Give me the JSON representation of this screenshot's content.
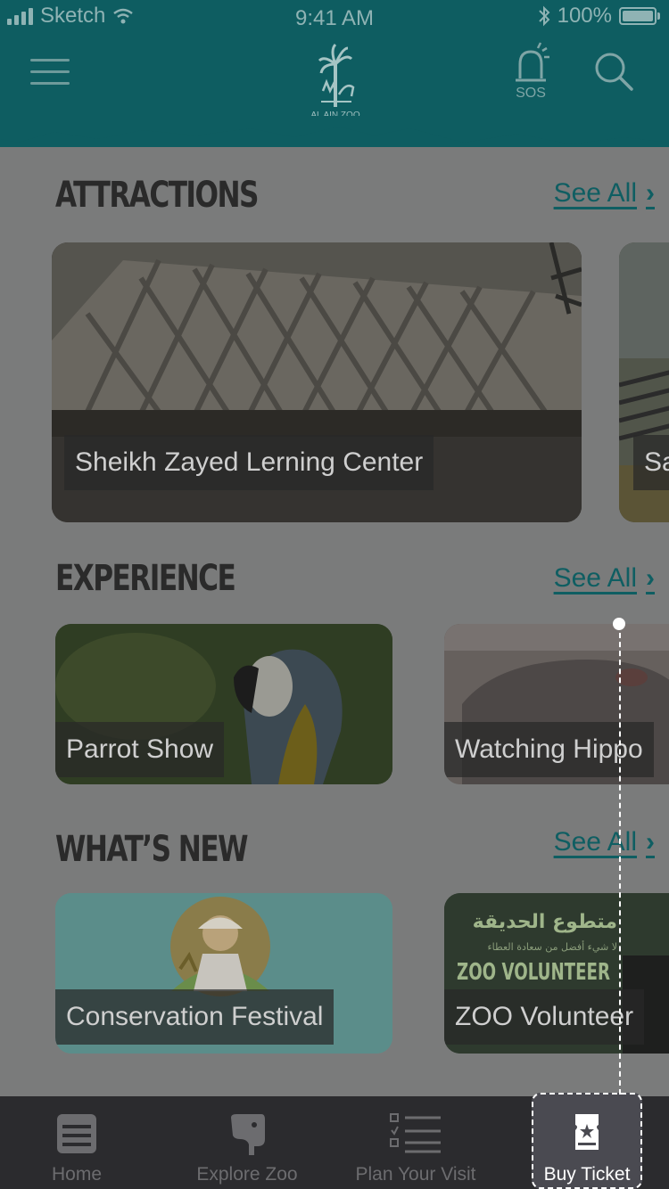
{
  "status_bar": {
    "carrier": "Sketch",
    "time": "9:41 AM",
    "battery": "100%"
  },
  "header": {
    "logo_text": "AL AIN ZOO",
    "sos_label": "SOS"
  },
  "sections": {
    "attractions": {
      "title": "ATTRACTIONS",
      "see_all": "See All",
      "cards": [
        {
          "label": "Sheikh Zayed Lerning Center"
        },
        {
          "label": "Sa"
        }
      ]
    },
    "experience": {
      "title": "EXPERIENCE",
      "see_all": "See All",
      "cards": [
        {
          "label": "Parrot Show"
        },
        {
          "label": "Watching Hippo"
        }
      ]
    },
    "whats_new": {
      "title": "WHAT’S NEW",
      "see_all": "See All",
      "cards": [
        {
          "label": "Conservation Festival"
        },
        {
          "label": "ZOO Volunteer",
          "poster_arabic": "متطوع الحديقة",
          "poster_arabic_sub": "لا شيء أفضل من سعادة العطاء",
          "poster_english": "ZOO VOLUNTEER"
        }
      ]
    }
  },
  "tab_bar": {
    "tabs": [
      {
        "label": "Home",
        "icon": "home-icon"
      },
      {
        "label": "Explore Zoo",
        "icon": "elephant-icon"
      },
      {
        "label": "Plan Your Visit",
        "icon": "checklist-icon"
      },
      {
        "label": "Buy Ticket",
        "icon": "ticket-icon",
        "active": true
      }
    ]
  },
  "colors": {
    "header": "#0e5d61",
    "accent": "#0f5e62",
    "overlay_bg": "#7a7b7b",
    "tabbar": "#2b2b2e"
  }
}
